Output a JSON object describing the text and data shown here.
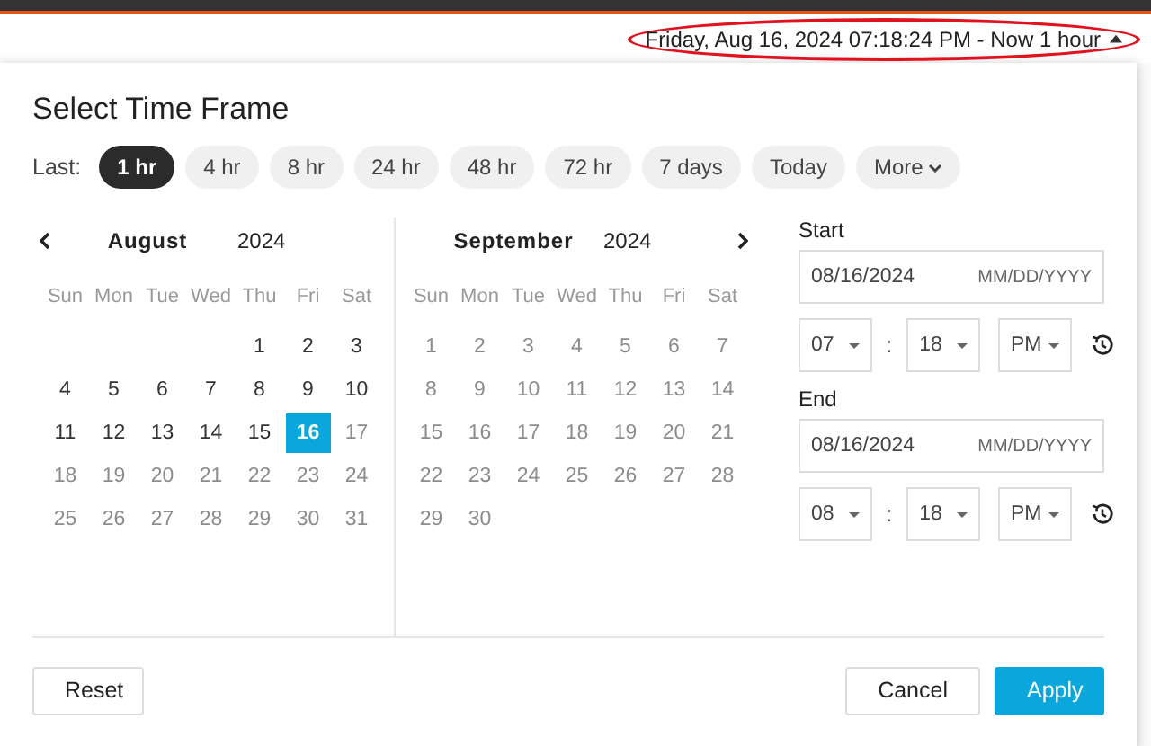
{
  "header": {
    "range_text": "Friday, Aug 16, 2024 07:18:24 PM - Now 1 hour",
    "highlighted": true
  },
  "dialog": {
    "title": "Select Time Frame",
    "last_label": "Last:",
    "presets": [
      {
        "label": "1 hr",
        "selected": true
      },
      {
        "label": "4 hr",
        "selected": false
      },
      {
        "label": "8 hr",
        "selected": false
      },
      {
        "label": "24 hr",
        "selected": false
      },
      {
        "label": "48 hr",
        "selected": false
      },
      {
        "label": "72 hr",
        "selected": false
      },
      {
        "label": "7 days",
        "selected": false
      },
      {
        "label": "Today",
        "selected": false
      },
      {
        "label": "More",
        "selected": false
      }
    ],
    "months": [
      {
        "name": "August",
        "year": "2024",
        "weekdays": [
          "Sun",
          "Mon",
          "Tue",
          "Wed",
          "Thu",
          "Fri",
          "Sat"
        ],
        "weeks": [
          {
            "days": [
              {
                "label": "1",
                "disabled": false,
                "selected": false
              },
              {
                "label": "2",
                "disabled": false,
                "selected": false
              },
              {
                "label": "3",
                "disabled": false,
                "selected": false
              }
            ]
          },
          {
            "days": [
              {
                "label": "4",
                "disabled": false,
                "selected": false
              },
              {
                "label": "5",
                "disabled": false,
                "selected": false
              },
              {
                "label": "6",
                "disabled": false,
                "selected": false
              },
              {
                "label": "7",
                "disabled": false,
                "selected": false
              },
              {
                "label": "8",
                "disabled": false,
                "selected": false
              },
              {
                "label": "9",
                "disabled": false,
                "selected": false
              },
              {
                "label": "10",
                "disabled": false,
                "selected": false
              }
            ]
          },
          {
            "days": [
              {
                "label": "11",
                "disabled": false,
                "selected": false
              },
              {
                "label": "12",
                "disabled": false,
                "selected": false
              },
              {
                "label": "13",
                "disabled": false,
                "selected": false
              },
              {
                "label": "14",
                "disabled": false,
                "selected": false
              },
              {
                "label": "15",
                "disabled": false,
                "selected": false
              },
              {
                "label": "16",
                "disabled": false,
                "selected": true
              },
              {
                "label": "17",
                "disabled": true,
                "selected": false
              }
            ]
          },
          {
            "days": [
              {
                "label": "18",
                "disabled": true,
                "selected": false
              },
              {
                "label": "19",
                "disabled": true,
                "selected": false
              },
              {
                "label": "20",
                "disabled": true,
                "selected": false
              },
              {
                "label": "21",
                "disabled": true,
                "selected": false
              },
              {
                "label": "22",
                "disabled": true,
                "selected": false
              },
              {
                "label": "23",
                "disabled": true,
                "selected": false
              },
              {
                "label": "24",
                "disabled": true,
                "selected": false
              }
            ]
          },
          {
            "days": [
              {
                "label": "25",
                "disabled": true,
                "selected": false
              },
              {
                "label": "26",
                "disabled": true,
                "selected": false
              },
              {
                "label": "27",
                "disabled": true,
                "selected": false
              },
              {
                "label": "28",
                "disabled": true,
                "selected": false
              },
              {
                "label": "29",
                "disabled": true,
                "selected": false
              },
              {
                "label": "30",
                "disabled": true,
                "selected": false
              },
              {
                "label": "31",
                "disabled": true,
                "selected": false
              }
            ]
          }
        ]
      },
      {
        "name": "September",
        "year": "2024",
        "weekdays": [
          "Sun",
          "Mon",
          "Tue",
          "Wed",
          "Thu",
          "Fri",
          "Sat"
        ],
        "weeks": [
          {
            "days": [
              {
                "label": "1",
                "disabled": true,
                "selected": false
              },
              {
                "label": "2",
                "disabled": true,
                "selected": false
              },
              {
                "label": "3",
                "disabled": true,
                "selected": false
              },
              {
                "label": "4",
                "disabled": true,
                "selected": false
              },
              {
                "label": "5",
                "disabled": true,
                "selected": false
              },
              {
                "label": "6",
                "disabled": true,
                "selected": false
              },
              {
                "label": "7",
                "disabled": true,
                "selected": false
              }
            ]
          },
          {
            "days": [
              {
                "label": "8",
                "disabled": true,
                "selected": false
              },
              {
                "label": "9",
                "disabled": true,
                "selected": false
              },
              {
                "label": "10",
                "disabled": true,
                "selected": false
              },
              {
                "label": "11",
                "disabled": true,
                "selected": false
              },
              {
                "label": "12",
                "disabled": true,
                "selected": false
              },
              {
                "label": "13",
                "disabled": true,
                "selected": false
              },
              {
                "label": "14",
                "disabled": true,
                "selected": false
              }
            ]
          },
          {
            "days": [
              {
                "label": "15",
                "disabled": true,
                "selected": false
              },
              {
                "label": "16",
                "disabled": true,
                "selected": false
              },
              {
                "label": "17",
                "disabled": true,
                "selected": false
              },
              {
                "label": "18",
                "disabled": true,
                "selected": false
              },
              {
                "label": "19",
                "disabled": true,
                "selected": false
              },
              {
                "label": "20",
                "disabled": true,
                "selected": false
              },
              {
                "label": "21",
                "disabled": true,
                "selected": false
              }
            ]
          },
          {
            "days": [
              {
                "label": "22",
                "disabled": true,
                "selected": false
              },
              {
                "label": "23",
                "disabled": true,
                "selected": false
              },
              {
                "label": "24",
                "disabled": true,
                "selected": false
              },
              {
                "label": "25",
                "disabled": true,
                "selected": false
              },
              {
                "label": "26",
                "disabled": true,
                "selected": false
              },
              {
                "label": "27",
                "disabled": true,
                "selected": false
              },
              {
                "label": "28",
                "disabled": true,
                "selected": false
              }
            ]
          },
          {
            "days": [
              {
                "label": "29",
                "disabled": true,
                "selected": false
              },
              {
                "label": "30",
                "disabled": true,
                "selected": false
              }
            ]
          }
        ]
      }
    ],
    "ranges": [
      {
        "label": "Start",
        "date": "08/16/2024",
        "format_hint": "MM/DD/YYYY",
        "hour": "07",
        "separator": ":",
        "minute": "18",
        "ampm": "PM"
      },
      {
        "label": "End",
        "date": "08/16/2024",
        "format_hint": "MM/DD/YYYY",
        "hour": "08",
        "separator": ":",
        "minute": "18",
        "ampm": "PM"
      }
    ],
    "buttons": [
      {
        "label": "Reset",
        "kind": "secondary"
      },
      {
        "label": "Cancel",
        "kind": "secondary"
      },
      {
        "label": "Apply",
        "kind": "primary"
      }
    ]
  }
}
